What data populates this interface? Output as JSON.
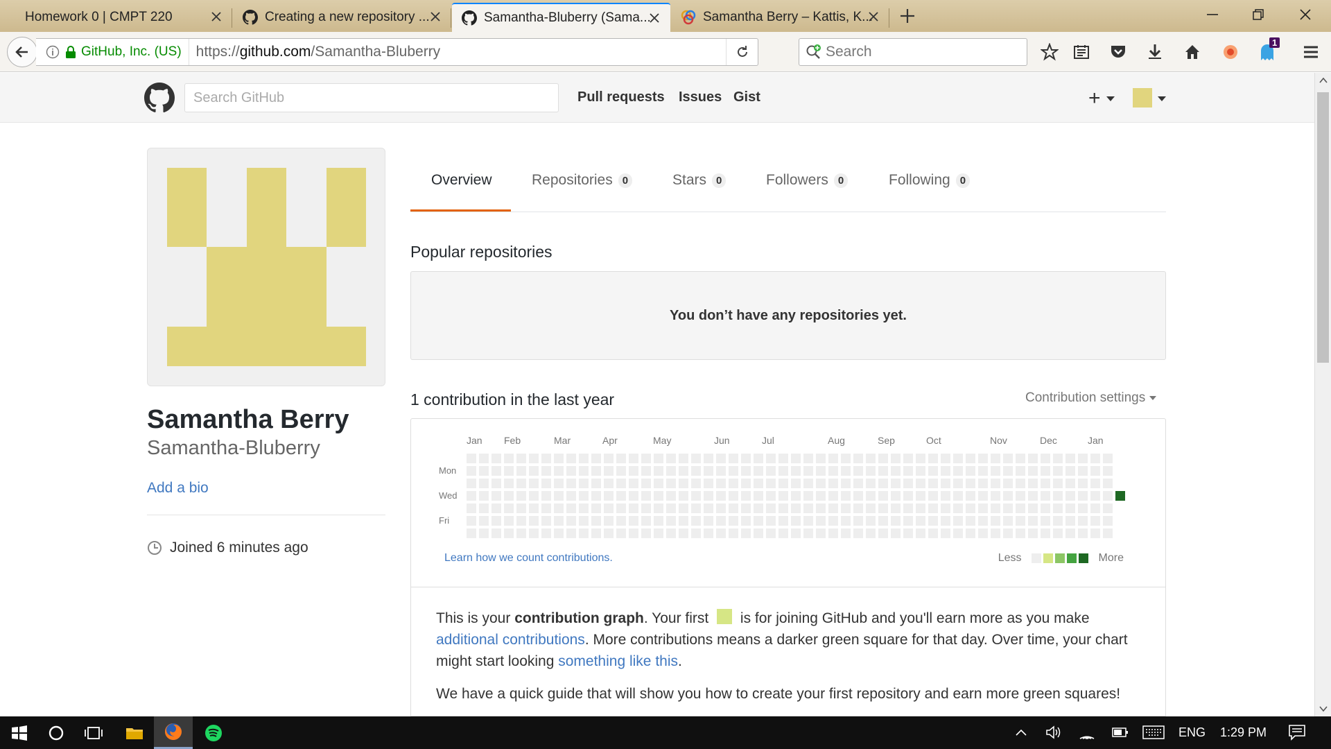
{
  "browser": {
    "tabs": [
      {
        "title": "Homework 0 | CMPT 220",
        "icon": "none"
      },
      {
        "title": "Creating a new repository ...",
        "icon": "github-icon"
      },
      {
        "title": "Samantha-Bluberry (Sama...",
        "icon": "github-icon"
      },
      {
        "title": "Samantha Berry – Kattis, K...",
        "icon": "kattis-icon"
      }
    ],
    "identity": "GitHub, Inc. (US)",
    "url_prefix": "https://",
    "url_host": "github.com",
    "url_path": "/Samantha-Bluberry",
    "search_placeholder": "Search",
    "notification_count": "1"
  },
  "github": {
    "search_placeholder": "Search GitHub",
    "nav": [
      "Pull requests",
      "Issues",
      "Gist"
    ],
    "plus": "+",
    "profile": {
      "fullname": "Samantha Berry",
      "username": "Samantha-Bluberry",
      "add_bio": "Add a bio",
      "joined": "Joined 6 minutes ago"
    },
    "tabs": [
      {
        "label": "Overview",
        "count": ""
      },
      {
        "label": "Repositories",
        "count": "0"
      },
      {
        "label": "Stars",
        "count": "0"
      },
      {
        "label": "Followers",
        "count": "0"
      },
      {
        "label": "Following",
        "count": "0"
      }
    ],
    "popular_title": "Popular repositories",
    "empty_repos": "You don’t have any repositories yet.",
    "contrib_title": "1 contribution in the last year",
    "contrib_settings": "Contribution settings",
    "months": [
      "Jan",
      "Feb",
      "Mar",
      "Apr",
      "May",
      "Jun",
      "Jul",
      "Aug",
      "Sep",
      "Oct",
      "Nov",
      "Dec",
      "Jan"
    ],
    "days": [
      "Mon",
      "Wed",
      "Fri"
    ],
    "learn_link": "Learn how we count contributions.",
    "legend_less": "Less",
    "legend_more": "More",
    "legend_colors": [
      "#eeeeee",
      "#d6e685",
      "#8cc665",
      "#44a340",
      "#1e6823"
    ],
    "active_color": "#1e6823",
    "info": {
      "p1_a": "This is your ",
      "p1_b": "contribution graph",
      "p1_c": ". Your first ",
      "p1_d": " is for joining GitHub and you'll earn more as you make ",
      "p1_link1": "additional contributions",
      "p1_e": ". More contributions means a darker green square for that day. Over time, your chart might start looking ",
      "p1_link2": "something like this",
      "p1_f": ".",
      "p2": "We have a quick guide that will show you how to create your first repository and earn more green squares!"
    }
  },
  "taskbar": {
    "lang": "ENG",
    "time": "1:29 PM"
  }
}
